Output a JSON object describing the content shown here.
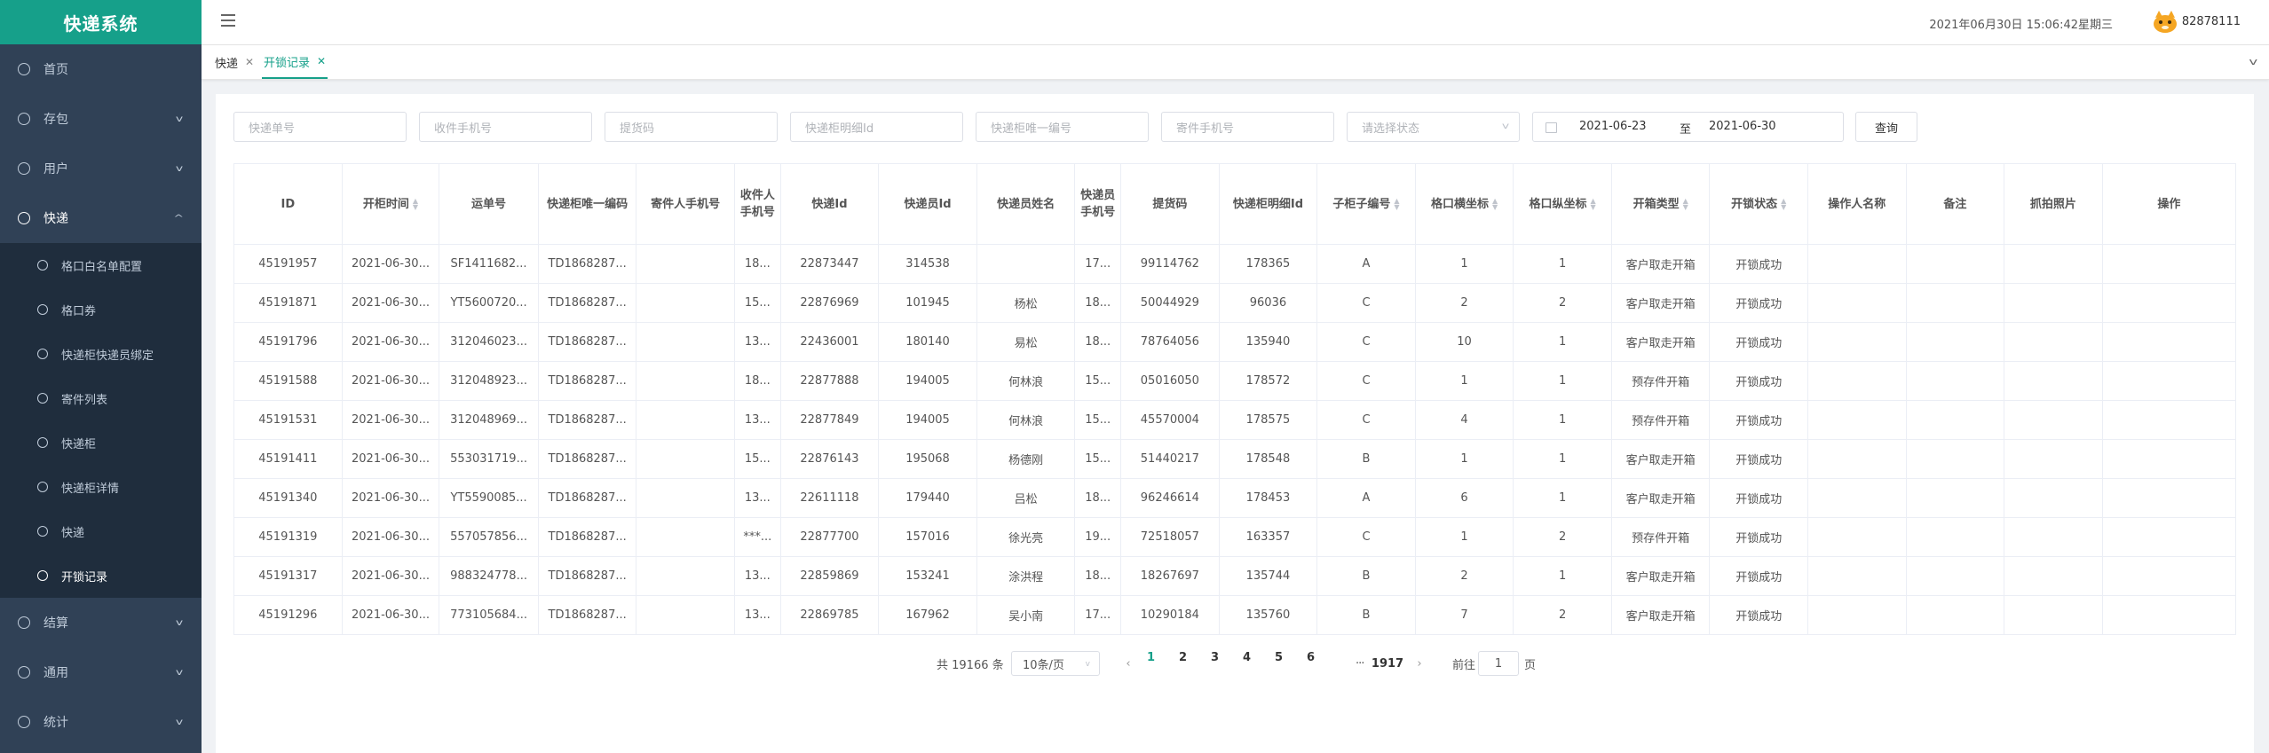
{
  "app": {
    "title": "快递系统"
  },
  "sidebar": {
    "items": [
      {
        "label": "首页",
        "has_arrow": false
      },
      {
        "label": "存包",
        "has_arrow": true
      },
      {
        "label": "用户",
        "has_arrow": true
      },
      {
        "label": "快递",
        "has_arrow": true,
        "open": true
      },
      {
        "label": "结算",
        "has_arrow": true
      },
      {
        "label": "通用",
        "has_arrow": true
      },
      {
        "label": "统计",
        "has_arrow": true
      }
    ],
    "sub_items": [
      {
        "label": "格口白名单配置"
      },
      {
        "label": "格口券"
      },
      {
        "label": "快递柜快递员绑定"
      },
      {
        "label": "寄件列表"
      },
      {
        "label": "快递柜"
      },
      {
        "label": "快递柜详情"
      },
      {
        "label": "快递"
      },
      {
        "label": "开锁记录",
        "active": true
      }
    ]
  },
  "header": {
    "datetime": "2021年06月30日 15:06:42星期三",
    "username": "82878111"
  },
  "tags": [
    {
      "label": "快递",
      "active": false
    },
    {
      "label": "开锁记录",
      "active": true
    }
  ],
  "filters": {
    "waybill_placeholder": "快递单号",
    "receiver_phone_placeholder": "收件手机号",
    "pickup_code_placeholder": "提货码",
    "cabinet_detail_id_placeholder": "快递柜明细Id",
    "cabinet_code_placeholder": "快递柜唯一编号",
    "sender_phone_placeholder": "寄件手机号",
    "status_placeholder": "请选择状态",
    "date_start": "2021-06-23",
    "date_sep": "至",
    "date_end": "2021-06-30",
    "query_label": "查询"
  },
  "table": {
    "columns": [
      "ID",
      "开柜时间",
      "运单号",
      "快递柜唯一编码",
      "寄件人手机号",
      "收件人手机号",
      "快递Id",
      "快递员Id",
      "快递员姓名",
      "快递员手机号",
      "提货码",
      "快递柜明细Id",
      "子柜子编号",
      "格口横坐标",
      "格口纵坐标",
      "开箱类型",
      "开锁状态",
      "操作人名称",
      "备注",
      "抓拍照片",
      "操作"
    ],
    "sortable": [
      false,
      true,
      false,
      false,
      false,
      false,
      false,
      false,
      false,
      false,
      false,
      false,
      true,
      true,
      true,
      true,
      true,
      false,
      false,
      false,
      false
    ],
    "rows": [
      [
        "45191957",
        "2021-06-30...",
        "SF1411682...",
        "TD1868287...",
        "",
        "18...",
        "22873447",
        "314538",
        "",
        "17...",
        "99114762",
        "178365",
        "A",
        "1",
        "1",
        "客户取走开箱",
        "开锁成功",
        "",
        "",
        "",
        ""
      ],
      [
        "45191871",
        "2021-06-30...",
        "YT5600720...",
        "TD1868287...",
        "",
        "15...",
        "22876969",
        "101945",
        "杨松",
        "18...",
        "50044929",
        "96036",
        "C",
        "2",
        "2",
        "客户取走开箱",
        "开锁成功",
        "",
        "",
        "",
        ""
      ],
      [
        "45191796",
        "2021-06-30...",
        "312046023...",
        "TD1868287...",
        "",
        "13...",
        "22436001",
        "180140",
        "易松",
        "18...",
        "78764056",
        "135940",
        "C",
        "10",
        "1",
        "客户取走开箱",
        "开锁成功",
        "",
        "",
        "",
        ""
      ],
      [
        "45191588",
        "2021-06-30...",
        "312048923...",
        "TD1868287...",
        "",
        "18...",
        "22877888",
        "194005",
        "何林浪",
        "15...",
        "05016050",
        "178572",
        "C",
        "1",
        "1",
        "预存件开箱",
        "开锁成功",
        "",
        "",
        "",
        ""
      ],
      [
        "45191531",
        "2021-06-30...",
        "312048969...",
        "TD1868287...",
        "",
        "13...",
        "22877849",
        "194005",
        "何林浪",
        "15...",
        "45570004",
        "178575",
        "C",
        "4",
        "1",
        "预存件开箱",
        "开锁成功",
        "",
        "",
        "",
        ""
      ],
      [
        "45191411",
        "2021-06-30...",
        "553031719...",
        "TD1868287...",
        "",
        "15...",
        "22876143",
        "195068",
        "杨德刚",
        "15...",
        "51440217",
        "178548",
        "B",
        "1",
        "1",
        "客户取走开箱",
        "开锁成功",
        "",
        "",
        "",
        ""
      ],
      [
        "45191340",
        "2021-06-30...",
        "YT5590085...",
        "TD1868287...",
        "",
        "13...",
        "22611118",
        "179440",
        "吕松",
        "18...",
        "96246614",
        "178453",
        "A",
        "6",
        "1",
        "客户取走开箱",
        "开锁成功",
        "",
        "",
        "",
        ""
      ],
      [
        "45191319",
        "2021-06-30...",
        "557057856...",
        "TD1868287...",
        "",
        "***...",
        "22877700",
        "157016",
        "徐光亮",
        "19...",
        "72518057",
        "163357",
        "C",
        "1",
        "2",
        "预存件开箱",
        "开锁成功",
        "",
        "",
        "",
        ""
      ],
      [
        "45191317",
        "2021-06-30...",
        "988324778...",
        "TD1868287...",
        "",
        "13...",
        "22859869",
        "153241",
        "涂洪程",
        "18...",
        "18267697",
        "135744",
        "B",
        "2",
        "1",
        "客户取走开箱",
        "开锁成功",
        "",
        "",
        "",
        ""
      ],
      [
        "45191296",
        "2021-06-30...",
        "773105684...",
        "TD1868287...",
        "",
        "13...",
        "22869785",
        "167962",
        "吴小南",
        "17...",
        "10290184",
        "135760",
        "B",
        "7",
        "2",
        "客户取走开箱",
        "开锁成功",
        "",
        "",
        "",
        ""
      ]
    ]
  },
  "pagination": {
    "total_text": "共 19166 条",
    "page_size": "10条/页",
    "pages": [
      "1",
      "2",
      "3",
      "4",
      "5",
      "6"
    ],
    "current": "1",
    "ellipsis": "···",
    "last_page": "1917",
    "goto_prefix": "前往",
    "goto_value": "1",
    "goto_suffix": "页"
  },
  "colors": {
    "accent": "#16a08a",
    "sidebar_bg": "#304156",
    "submenu_bg": "#1f2d3d"
  },
  "icons": {
    "sidebar": "circle-icon",
    "menu_toggle": "hamburger-icon",
    "avatar": "orange-cat-avatar-icon"
  }
}
